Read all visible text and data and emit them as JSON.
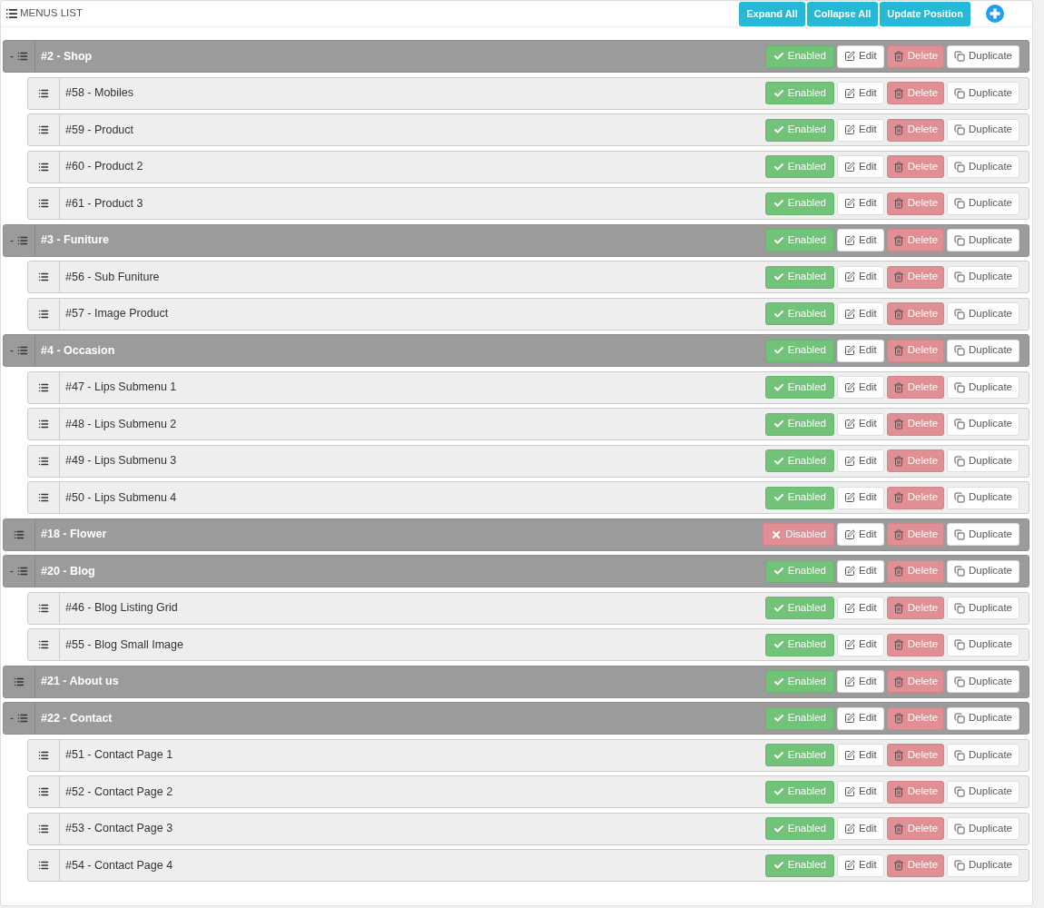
{
  "header": {
    "title": "MENUS LIST",
    "buttons": [
      "Expand All",
      "Collapse All",
      "Update Position"
    ]
  },
  "menus": [
    {
      "toggle": "-",
      "label": "#2 - Shop",
      "enabled": true,
      "status": "Enabled",
      "edit": "Edit",
      "delete": "Delete",
      "duplicate": "Duplicate",
      "children": [
        {
          "label": "#58 - Mobiles",
          "enabled": true,
          "status": "Enabled",
          "edit": "Edit",
          "delete": "Delete",
          "duplicate": "Duplicate"
        },
        {
          "label": "#59 - Product",
          "enabled": true,
          "status": "Enabled",
          "edit": "Edit",
          "delete": "Delete",
          "duplicate": "Duplicate"
        },
        {
          "label": "#60 - Product 2",
          "enabled": true,
          "status": "Enabled",
          "edit": "Edit",
          "delete": "Delete",
          "duplicate": "Duplicate"
        },
        {
          "label": "#61 - Product 3",
          "enabled": true,
          "status": "Enabled",
          "edit": "Edit",
          "delete": "Delete",
          "duplicate": "Duplicate"
        }
      ]
    },
    {
      "toggle": "-",
      "label": "#3 - Funiture",
      "enabled": true,
      "status": "Enabled",
      "edit": "Edit",
      "delete": "Delete",
      "duplicate": "Duplicate",
      "children": [
        {
          "label": "#56 - Sub Funiture",
          "enabled": true,
          "status": "Enabled",
          "edit": "Edit",
          "delete": "Delete",
          "duplicate": "Duplicate"
        },
        {
          "label": "#57 - Image Product",
          "enabled": true,
          "status": "Enabled",
          "edit": "Edit",
          "delete": "Delete",
          "duplicate": "Duplicate"
        }
      ]
    },
    {
      "toggle": "-",
      "label": "#4 - Occasion",
      "enabled": true,
      "status": "Enabled",
      "edit": "Edit",
      "delete": "Delete",
      "duplicate": "Duplicate",
      "children": [
        {
          "label": "#47 - Lips Submenu 1",
          "enabled": true,
          "status": "Enabled",
          "edit": "Edit",
          "delete": "Delete",
          "duplicate": "Duplicate"
        },
        {
          "label": "#48 - Lips Submenu 2",
          "enabled": true,
          "status": "Enabled",
          "edit": "Edit",
          "delete": "Delete",
          "duplicate": "Duplicate"
        },
        {
          "label": "#49 - Lips Submenu 3",
          "enabled": true,
          "status": "Enabled",
          "edit": "Edit",
          "delete": "Delete",
          "duplicate": "Duplicate"
        },
        {
          "label": "#50 - Lips Submenu 4",
          "enabled": true,
          "status": "Enabled",
          "edit": "Edit",
          "delete": "Delete",
          "duplicate": "Duplicate"
        }
      ]
    },
    {
      "label": "#18 - Flower",
      "enabled": false,
      "status": "Disabled",
      "edit": "Edit",
      "delete": "Delete",
      "duplicate": "Duplicate"
    },
    {
      "toggle": "-",
      "label": "#20 - Blog",
      "enabled": true,
      "status": "Enabled",
      "edit": "Edit",
      "delete": "Delete",
      "duplicate": "Duplicate",
      "children": [
        {
          "label": "#46 - Blog Listing Grid",
          "enabled": true,
          "status": "Enabled",
          "edit": "Edit",
          "delete": "Delete",
          "duplicate": "Duplicate"
        },
        {
          "label": "#55 - Blog Small Image",
          "enabled": true,
          "status": "Enabled",
          "edit": "Edit",
          "delete": "Delete",
          "duplicate": "Duplicate"
        }
      ]
    },
    {
      "label": "#21 - About us",
      "enabled": true,
      "status": "Enabled",
      "edit": "Edit",
      "delete": "Delete",
      "duplicate": "Duplicate"
    },
    {
      "toggle": "-",
      "label": "#22 - Contact",
      "enabled": true,
      "status": "Enabled",
      "edit": "Edit",
      "delete": "Delete",
      "duplicate": "Duplicate",
      "children": [
        {
          "label": "#51 - Contact Page 1",
          "enabled": true,
          "status": "Enabled",
          "edit": "Edit",
          "delete": "Delete",
          "duplicate": "Duplicate"
        },
        {
          "label": "#52 - Contact Page 2",
          "enabled": true,
          "status": "Enabled",
          "edit": "Edit",
          "delete": "Delete",
          "duplicate": "Duplicate"
        },
        {
          "label": "#53 - Contact Page 3",
          "enabled": true,
          "status": "Enabled",
          "edit": "Edit",
          "delete": "Delete",
          "duplicate": "Duplicate"
        },
        {
          "label": "#54 - Contact Page 4",
          "enabled": true,
          "status": "Enabled",
          "edit": "Edit",
          "delete": "Delete",
          "duplicate": "Duplicate"
        }
      ]
    }
  ]
}
